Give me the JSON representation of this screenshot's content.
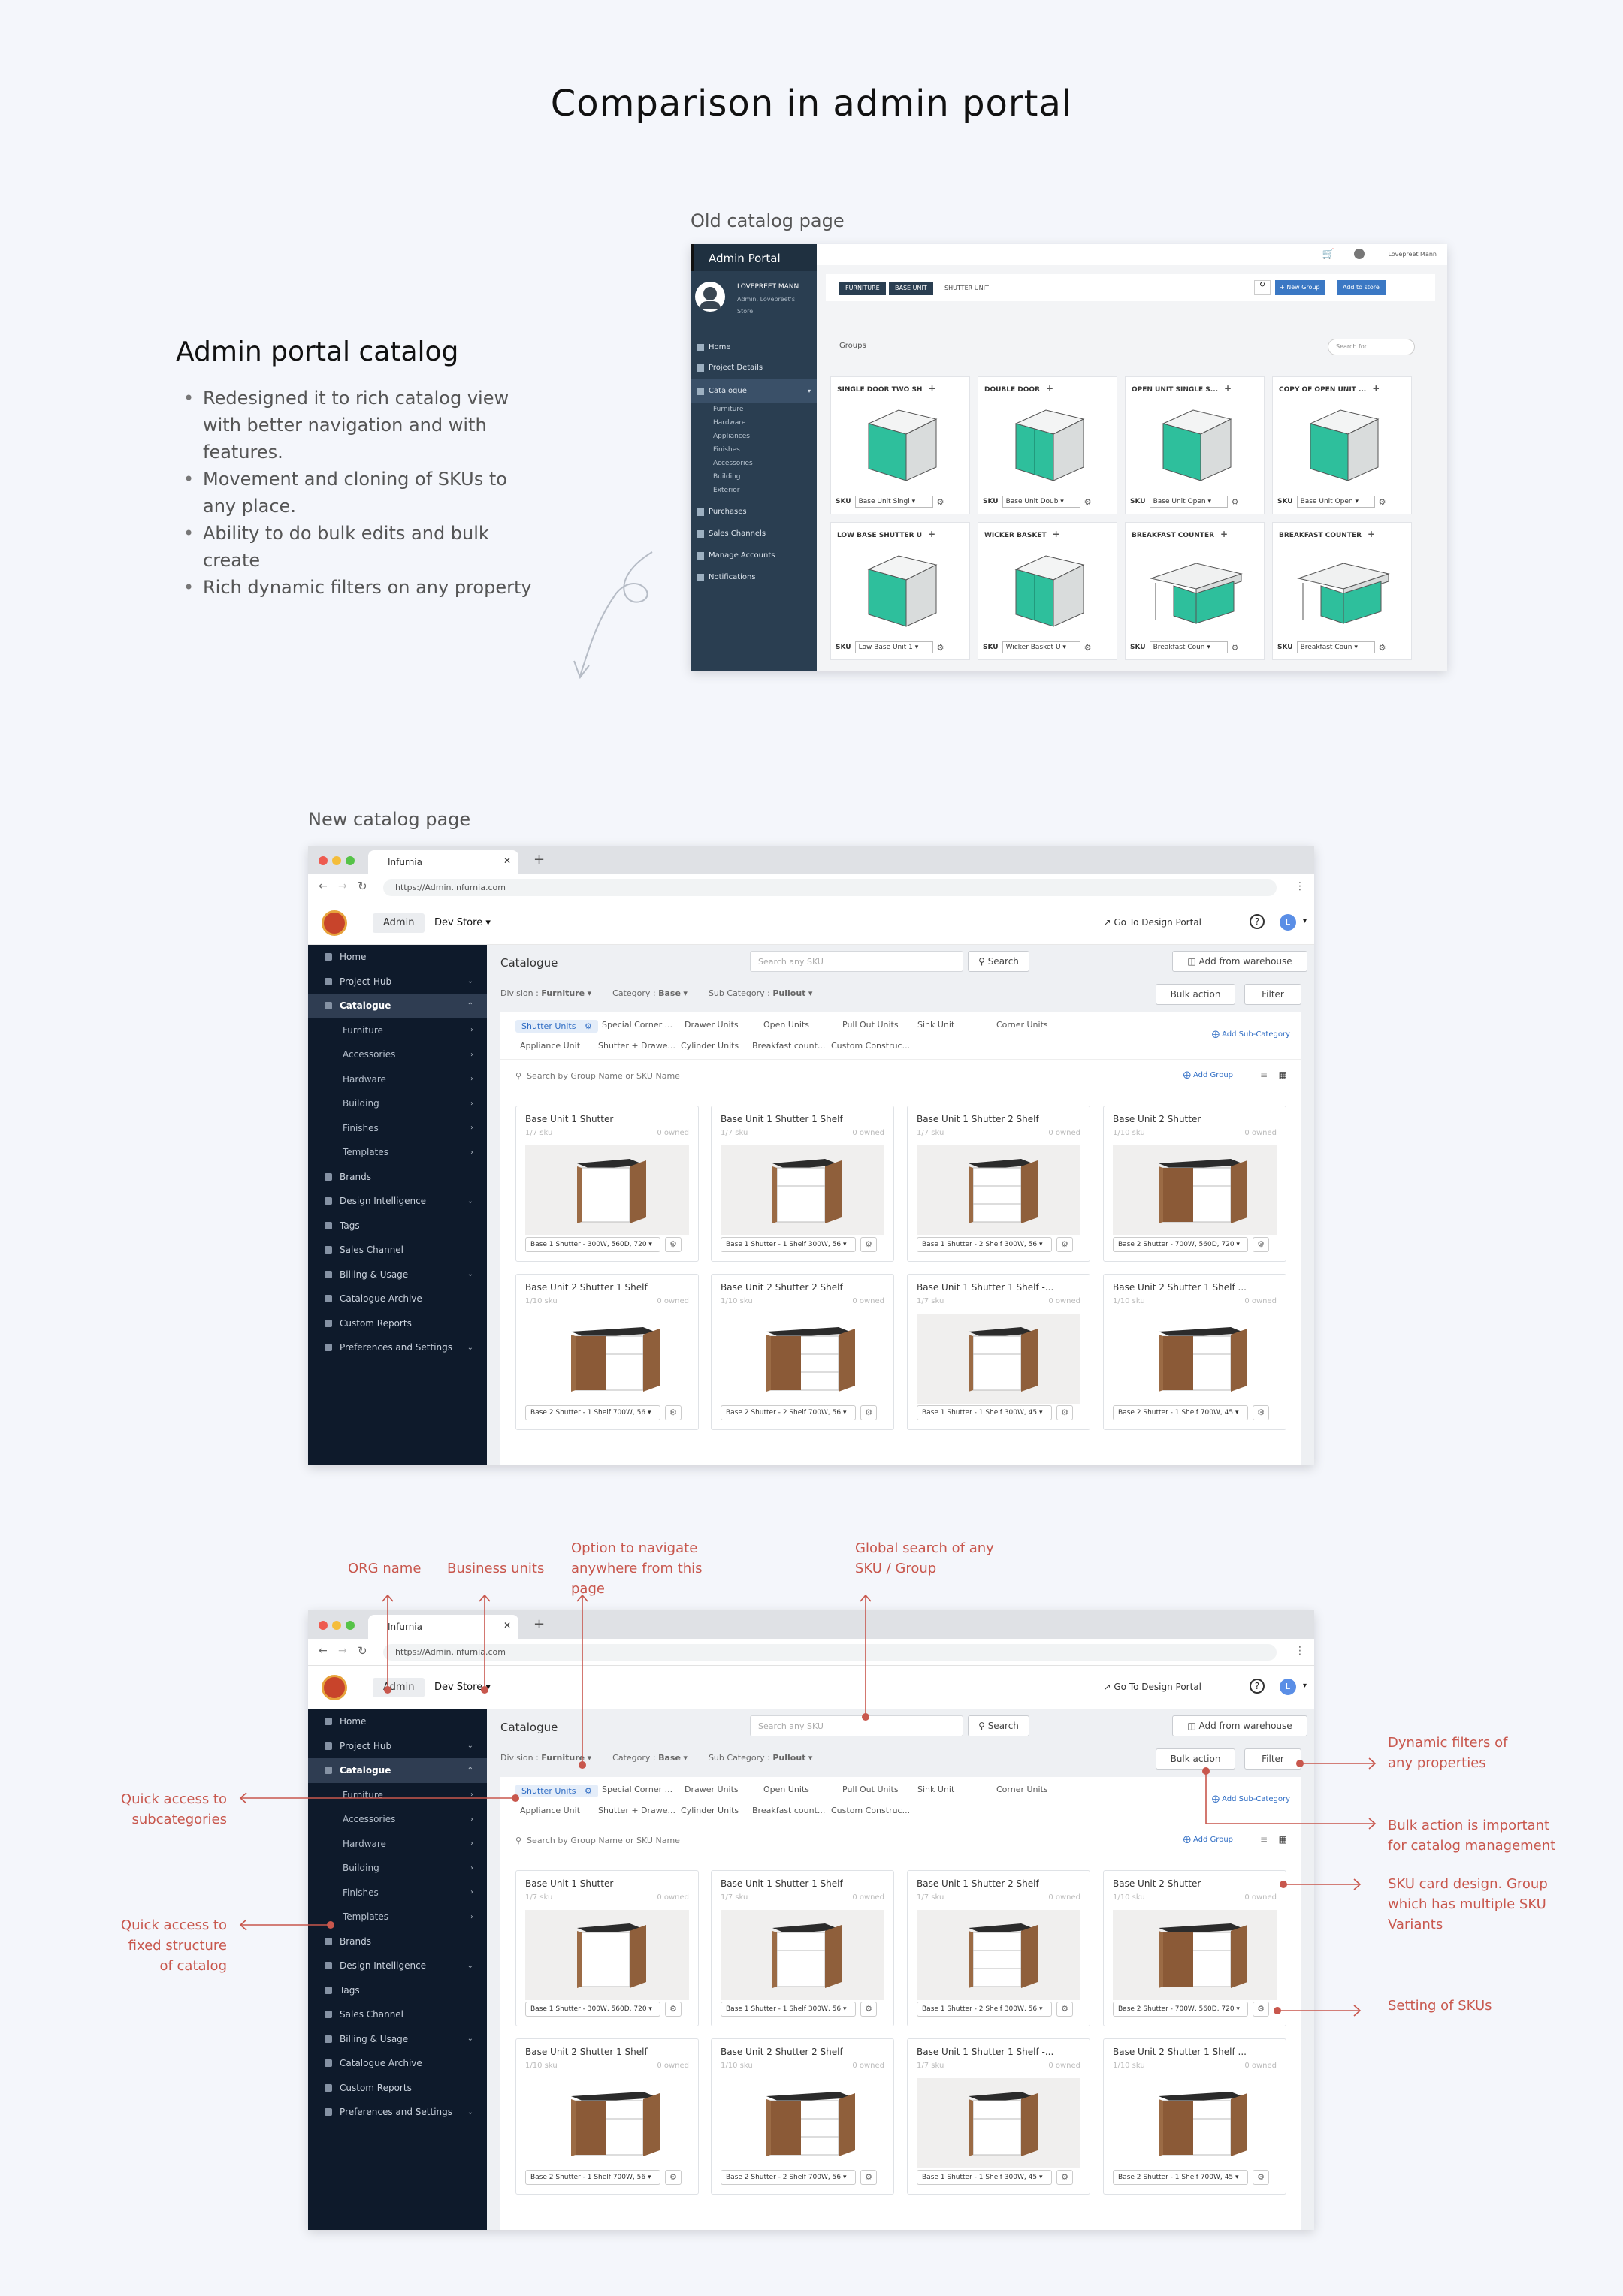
{
  "page_title": "Comparison  in admin portal",
  "intro": {
    "title": "Admin portal catalog",
    "bullets": [
      "Redesigned it to rich catalog view with better navigation and with features.",
      "Movement  and cloning of SKUs to any place.",
      "Ability to do bulk edits and bulk create",
      "Rich dynamic filters on any property"
    ]
  },
  "captions": {
    "old": "Old  catalog page",
    "new": "New catalog page"
  },
  "old_page": {
    "brand": "Admin Portal",
    "user_name": "LOVEPREET MANN",
    "user_role": "Admin, Lovepreet's Store",
    "top_user": "Lovepreet Mann",
    "nav": [
      "Home",
      "Project Details",
      "Catalogue",
      "Purchases",
      "Sales Channels",
      "Manage Accounts",
      "Notifications"
    ],
    "sub_nav": [
      "Furniture",
      "Hardware",
      "Appliances",
      "Finishes",
      "Accessories",
      "Building",
      "Exterior"
    ],
    "breadcrumb": [
      "FURNITURE",
      "BASE UNIT",
      "SHUTTER UNIT"
    ],
    "new_group": "+ New Group",
    "add_to_store": "Add to store",
    "groups_label": "Groups",
    "search_placeholder": "Search for...",
    "sku_label": "SKU",
    "cards": [
      {
        "title": "SINGLE DOOR TWO SH",
        "sku": "Base Unit Singl"
      },
      {
        "title": "DOUBLE DOOR",
        "sku": "Base Unit Doub"
      },
      {
        "title": "OPEN UNIT SINGLE S...",
        "sku": "Base Unit Open"
      },
      {
        "title": "COPY OF OPEN UNIT ...",
        "sku": "Base Unit Open"
      },
      {
        "title": "LOW BASE SHUTTER U",
        "sku": "Low Base Unit 1"
      },
      {
        "title": "WICKER BASKET",
        "sku": "Wicker Basket U"
      },
      {
        "title": "BREAKFAST COUNTER",
        "sku": "Breakfast Coun"
      },
      {
        "title": "BREAKFAST COUNTER",
        "sku": "Breakfast Coun"
      }
    ]
  },
  "new_page": {
    "tab_title": "Infurnia",
    "url": "https://Admin.infurnia.com",
    "org": "Admin",
    "store": "Dev Store",
    "go_design": "Go To Design Portal",
    "avatar": "L",
    "side": [
      {
        "label": "Home"
      },
      {
        "label": "Project Hub",
        "chev": "v"
      },
      {
        "label": "Catalogue",
        "chev": "^",
        "active": true
      },
      {
        "label": "Furniture",
        "sub": true,
        "chev": ">"
      },
      {
        "label": "Accessories",
        "sub": true,
        "chev": ">"
      },
      {
        "label": "Hardware",
        "sub": true,
        "chev": ">"
      },
      {
        "label": "Building",
        "sub": true,
        "chev": ">"
      },
      {
        "label": "Finishes",
        "sub": true,
        "chev": ">"
      },
      {
        "label": "Templates",
        "sub": true,
        "chev": ">"
      },
      {
        "label": "Brands"
      },
      {
        "label": "Design Intelligence",
        "chev": "v"
      },
      {
        "label": "Tags"
      },
      {
        "label": "Sales Channel"
      },
      {
        "label": "Billing & Usage",
        "chev": "v"
      },
      {
        "label": "Catalogue Archive"
      },
      {
        "label": "Custom Reports"
      },
      {
        "label": "Preferences and Settings",
        "chev": "v"
      }
    ],
    "heading": "Catalogue",
    "search_placeholder": "Search any SKU",
    "search_btn": "Search",
    "add_warehouse": "Add from warehouse",
    "division_label": "Division :",
    "division": "Furniture",
    "category_label": "Category :",
    "category": "Base",
    "subcategory_label": "Sub Category :",
    "subcategory": "Pullout",
    "bulk_action": "Bulk action",
    "filter": "Filter",
    "chips_row1": [
      "Shutter Units",
      "Special Corner ...",
      "Drawer Units",
      "Open Units",
      "Pull Out Units",
      "Sink Unit",
      "Corner Units"
    ],
    "chips_row2": [
      "Appliance Unit",
      "Shutter + Drawe...",
      "Cylinder Units",
      "Breakfast count...",
      "Custom Construc..."
    ],
    "add_subcategory": "Add Sub-Category",
    "group_search": "Search by Group Name or SKU Name",
    "add_group": "Add Group",
    "cards": [
      {
        "title": "Base Unit 1 Shutter",
        "count": "1/7 sku",
        "owned": "0 owned",
        "sku": "Base 1 Shutter - 300W, 560D, 720"
      },
      {
        "title": "Base Unit 1 Shutter 1 Shelf",
        "count": "1/7 sku",
        "owned": "0 owned",
        "sku": "Base 1 Shutter - 1 Shelf 300W, 56"
      },
      {
        "title": "Base Unit 1 Shutter 2 Shelf",
        "count": "1/7 sku",
        "owned": "0 owned",
        "sku": "Base 1 Shutter - 2 Shelf 300W, 56"
      },
      {
        "title": "Base Unit 2 Shutter",
        "count": "1/10 sku",
        "owned": "0 owned",
        "sku": "Base 2 Shutter - 700W, 560D, 720"
      },
      {
        "title": "Base Unit 2 Shutter 1 Shelf",
        "count": "1/10 sku",
        "owned": "0 owned",
        "sku": "Base 2 Shutter - 1 Shelf 700W, 56"
      },
      {
        "title": "Base Unit 2 Shutter 2 Shelf",
        "count": "1/10 sku",
        "owned": "0 owned",
        "sku": "Base 2 Shutter - 2 Shelf 700W, 56"
      },
      {
        "title": "Base Unit 1 Shutter 1 Shelf -...",
        "count": "1/7 sku",
        "owned": "0 owned",
        "sku": "Base 1 Shutter - 1 Shelf 300W, 45"
      },
      {
        "title": "Base Unit 2 Shutter 1 Shelf ...",
        "count": "1/10 sku",
        "owned": "0 owned",
        "sku": "Base 2 Shutter - 1 Shelf 700W, 45"
      }
    ]
  },
  "annotations": {
    "org_name": "ORG name",
    "business_units": "Business units",
    "navigate": "Option to navigate anywhere from this page",
    "global_search": "Global search of any SKU / Group",
    "dynamic_filters": "Dynamic filters of any properties",
    "bulk_action": "Bulk action is important for catalog management",
    "sku_card": "SKU card design. Group which has multiple SKU Variants",
    "sku_setting": "Setting of SKUs",
    "quick_sub": "Quick access to subcategories",
    "quick_fixed": "Quick access to fixed structure of catalog"
  }
}
